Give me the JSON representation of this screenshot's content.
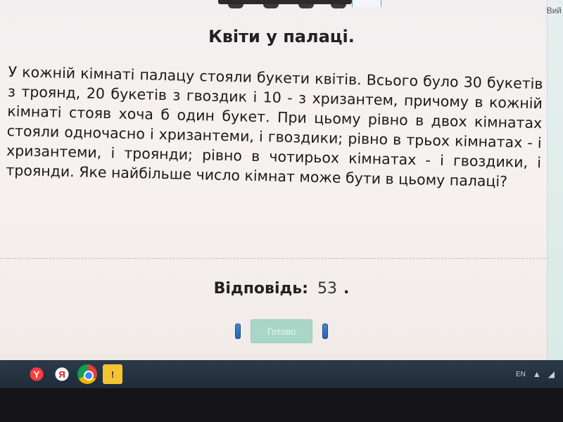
{
  "window": {
    "exit_label": "Вий"
  },
  "task": {
    "title": "Квіти у палаці.",
    "problem_text": "У кожній кімнаті палацу стояли букети квітів. Всього було 30 букетів з троянд, 20 букетів з гвоздик і 10 - з хризантем, причому в кожній кімнаті стояв хоча б один букет. При цьому рівно в двох кімнатах стояли одночасно і хризантеми, і гвоздики; рівно в трьох кімнатах - і хризантеми, і троянди; рівно в чотирьох кімнатах - і гвоздики, і троянди. Яке найбільше число кімнат може бути в цьому палаці?"
  },
  "answer": {
    "label": "Відповідь:",
    "value": "53",
    "trailing": "."
  },
  "actions": {
    "done_label": "Готово"
  },
  "taskbar": {
    "icons": [
      {
        "name": "yandex-browser-icon",
        "glyph": "Y"
      },
      {
        "name": "yandex-icon",
        "glyph": "Я"
      },
      {
        "name": "chrome-icon",
        "glyph": ""
      },
      {
        "name": "warning-icon",
        "glyph": "!"
      }
    ],
    "tray": {
      "language": "EN",
      "signal_glyph": "▲",
      "sound_glyph": "◢"
    }
  },
  "colors": {
    "done_button": "#a9d6c6",
    "handle": "#2a63b0",
    "taskbar": "#1f2b38"
  }
}
